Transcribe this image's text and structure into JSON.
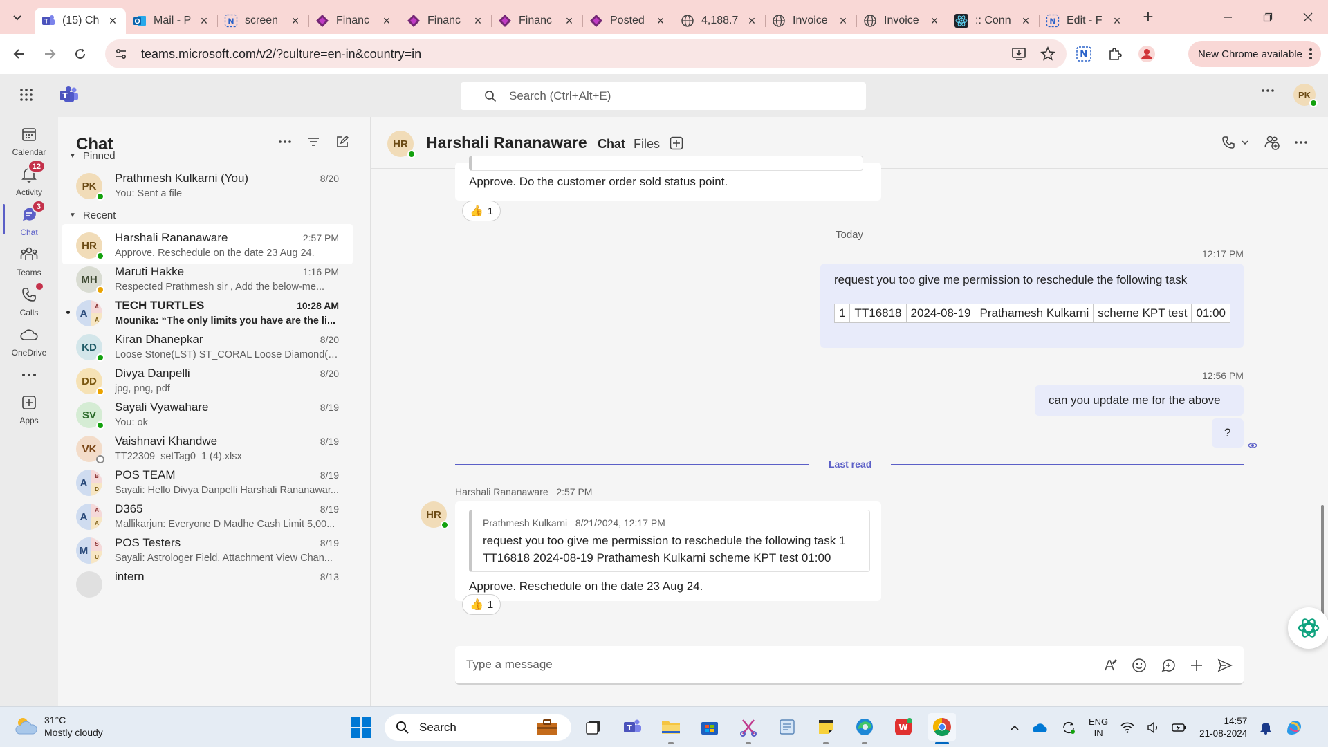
{
  "browser": {
    "tabs": [
      {
        "title": "(15) Ch",
        "icon": "teams-icon",
        "active": true
      },
      {
        "title": "Mail - P",
        "icon": "outlook-icon"
      },
      {
        "title": "screen",
        "icon": "app-n-icon"
      },
      {
        "title": "Financ",
        "icon": "power-apps-icon"
      },
      {
        "title": "Financ",
        "icon": "power-apps-icon"
      },
      {
        "title": "Financ",
        "icon": "power-apps-icon"
      },
      {
        "title": "Posted",
        "icon": "power-apps-icon"
      },
      {
        "title": "4,188.7",
        "icon": "globe-icon"
      },
      {
        "title": "Invoice",
        "icon": "globe-icon"
      },
      {
        "title": "Invoice",
        "icon": "globe-icon"
      },
      {
        "title": ":: Conn",
        "icon": "react-icon"
      },
      {
        "title": "Edit - F",
        "icon": "app-n-icon"
      }
    ],
    "url": "teams.microsoft.com/v2/?culture=en-in&country=in",
    "update_label": "New Chrome available",
    "colors": {
      "tabstrip": "#f9d8d6",
      "omnibox": "#f9e6e5"
    }
  },
  "teams": {
    "search_placeholder": "Search (Ctrl+Alt+E)",
    "user_initials": "PK",
    "accent": "#5b5fc7"
  },
  "rail": [
    {
      "label": "Calendar",
      "icon": "calendar-icon"
    },
    {
      "label": "Activity",
      "icon": "bell-icon",
      "badge": "12"
    },
    {
      "label": "Chat",
      "icon": "chat-icon",
      "badge": "3",
      "active": true
    },
    {
      "label": "Teams",
      "icon": "teams-people-icon"
    },
    {
      "label": "Calls",
      "icon": "phone-icon",
      "dot": true
    },
    {
      "label": "OneDrive",
      "icon": "cloud-icon"
    },
    {
      "label": "",
      "icon": "more-icon"
    },
    {
      "label": "Apps",
      "icon": "apps-add-icon"
    }
  ],
  "chatlist": {
    "title": "Chat",
    "pinned_label": "Pinned",
    "recent_label": "Recent",
    "pinned": [
      {
        "initials": "PK",
        "name": "Prathmesh Kulkarni (You)",
        "time": "8/20",
        "preview": "You: Sent a file",
        "presence": "available",
        "avatar_bg": "#f1dcb8",
        "avatar_fg": "#6b4a14"
      }
    ],
    "recent": [
      {
        "initials": "HR",
        "name": "Harshali Rananaware",
        "time": "2:57 PM",
        "preview": "Approve. Reschedule on the date 23 Aug 24.",
        "presence": "available",
        "selected": true,
        "avatar_bg": "#f1dcb8",
        "avatar_fg": "#6b4a14"
      },
      {
        "initials": "MH",
        "name": "Maruti Hakke",
        "time": "1:16 PM",
        "preview": "Respected  Prathmesh sir ,   Add the below-me...",
        "presence": "away",
        "avatar_bg": "#d9dcd2",
        "avatar_fg": "#3f4a33"
      },
      {
        "group": true,
        "initials": "A",
        "mini_a": "A",
        "mini_b": "A",
        "name": "TECH TURTLES",
        "time": "10:28 AM",
        "preview": "Mounika: “The only limits you have are the li...",
        "unread": true
      },
      {
        "initials": "KD",
        "name": "Kiran Dhanepkar",
        "time": "8/20",
        "preview": "Loose Stone(LST) ST_CORAL Loose Diamond(LS...",
        "presence": "available",
        "avatar_bg": "#d3e6ea",
        "avatar_fg": "#1e5a66"
      },
      {
        "initials": "DD",
        "name": "Divya Danpelli",
        "time": "8/20",
        "preview": "jpg, png, pdf",
        "presence": "away",
        "avatar_bg": "#f6e2b5",
        "avatar_fg": "#7a5710"
      },
      {
        "initials": "SV",
        "name": "Sayali Vyawahare",
        "time": "8/19",
        "preview": "You: ok",
        "presence": "available",
        "avatar_bg": "#d5ecd4",
        "avatar_fg": "#2b6a2a"
      },
      {
        "initials": "VK",
        "name": "Vaishnavi Khandwe",
        "time": "8/19",
        "preview": "TT22309_setTag0_1 (4).xlsx",
        "presence": "offline",
        "avatar_bg": "#f3dcc9",
        "avatar_fg": "#7a4616"
      },
      {
        "group": true,
        "initials": "A",
        "mini_a": "B",
        "mini_b": "D",
        "name": "POS TEAM",
        "time": "8/19",
        "preview": "Sayali: Hello Divya Danpelli Harshali Rananawar..."
      },
      {
        "group": true,
        "initials": "A",
        "mini_a": "A",
        "mini_b": "A",
        "name": "D365",
        "time": "8/19",
        "preview": "Mallikarjun: Everyone D Madhe Cash Limit  5,00..."
      },
      {
        "group": true,
        "initials": "M",
        "mini_a": "S",
        "mini_b": "U",
        "name": "POS Testers",
        "time": "8/19",
        "preview": "Sayali: Astrologer Field, Attachment View Chan..."
      },
      {
        "initials": "",
        "name": "intern",
        "time": "8/13",
        "preview": "",
        "avatar_bg": "#e0e0e0",
        "avatar_fg": "#424242"
      }
    ]
  },
  "conversation": {
    "initials": "HR",
    "name": "Harshali Rananaware",
    "tabs": [
      "Chat",
      "Files"
    ],
    "messages": {
      "top_reply": "Approve. Do the customer order sold status point.",
      "top_reaction_count": "1",
      "day_divider": "Today",
      "out1_time": "12:17 PM",
      "out1_text": "request you too give me permission to reschedule the following task",
      "out1_table": [
        "1",
        "TT16818",
        "2024-08-19",
        "Prathamesh Kulkarni",
        "scheme KPT test",
        "01:00"
      ],
      "out2_time": "12:56 PM",
      "out2_text": "can you update me for the above",
      "out3_text": "?",
      "last_read": "Last read",
      "in_sender": "Harshali Rananaware",
      "in_time": "2:57 PM",
      "quote_author": "Prathmesh Kulkarni",
      "quote_time": "8/21/2024, 12:17 PM",
      "quote_line1": "request you too give me permission to reschedule the following task 1",
      "quote_line2": "TT16818 2024-08-19 Prathamesh Kulkarni scheme KPT test 01:00",
      "in_text": "Approve. Reschedule on the date 23 Aug 24.",
      "in_reaction_count": "1"
    },
    "compose_placeholder": "Type a message"
  },
  "taskbar": {
    "weather_temp": "31°C",
    "weather_desc": "Mostly cloudy",
    "search_label": "Search",
    "lang_line1": "ENG",
    "lang_line2": "IN",
    "time": "14:57",
    "date": "21-08-2024"
  }
}
